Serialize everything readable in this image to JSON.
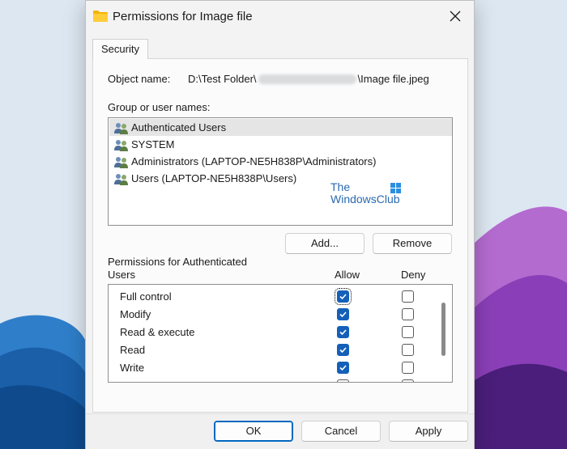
{
  "window": {
    "title": "Permissions for Image file"
  },
  "tabs": [
    {
      "label": "Security"
    }
  ],
  "object": {
    "label": "Object name:",
    "path_prefix": "D:\\Test Folder\\",
    "path_suffix": "\\Image file.jpeg"
  },
  "groups": {
    "label": "Group or user names:",
    "items": [
      {
        "name": "Authenticated Users",
        "selected": true
      },
      {
        "name": "SYSTEM",
        "selected": false
      },
      {
        "name": "Administrators (LAPTOP-NE5H838P\\Administrators)",
        "selected": false
      },
      {
        "name": "Users (LAPTOP-NE5H838P\\Users)",
        "selected": false
      }
    ],
    "add_label": "Add...",
    "remove_label": "Remove"
  },
  "watermark": {
    "line1": "The",
    "line2": "WindowsClub"
  },
  "permissions": {
    "label_line1": "Permissions for Authenticated",
    "label_line2": "Users",
    "allow_header": "Allow",
    "deny_header": "Deny",
    "rows": [
      {
        "name": "Full control",
        "allow": true,
        "deny": false
      },
      {
        "name": "Modify",
        "allow": true,
        "deny": false
      },
      {
        "name": "Read & execute",
        "allow": true,
        "deny": false
      },
      {
        "name": "Read",
        "allow": true,
        "deny": false
      },
      {
        "name": "Write",
        "allow": true,
        "deny": false
      }
    ]
  },
  "footer": {
    "ok_label": "OK",
    "cancel_label": "Cancel",
    "apply_label": "Apply"
  },
  "colors": {
    "accent": "#0067c0",
    "checkbox_checked": "#1460b8",
    "watermark": "#2a6ab0"
  }
}
